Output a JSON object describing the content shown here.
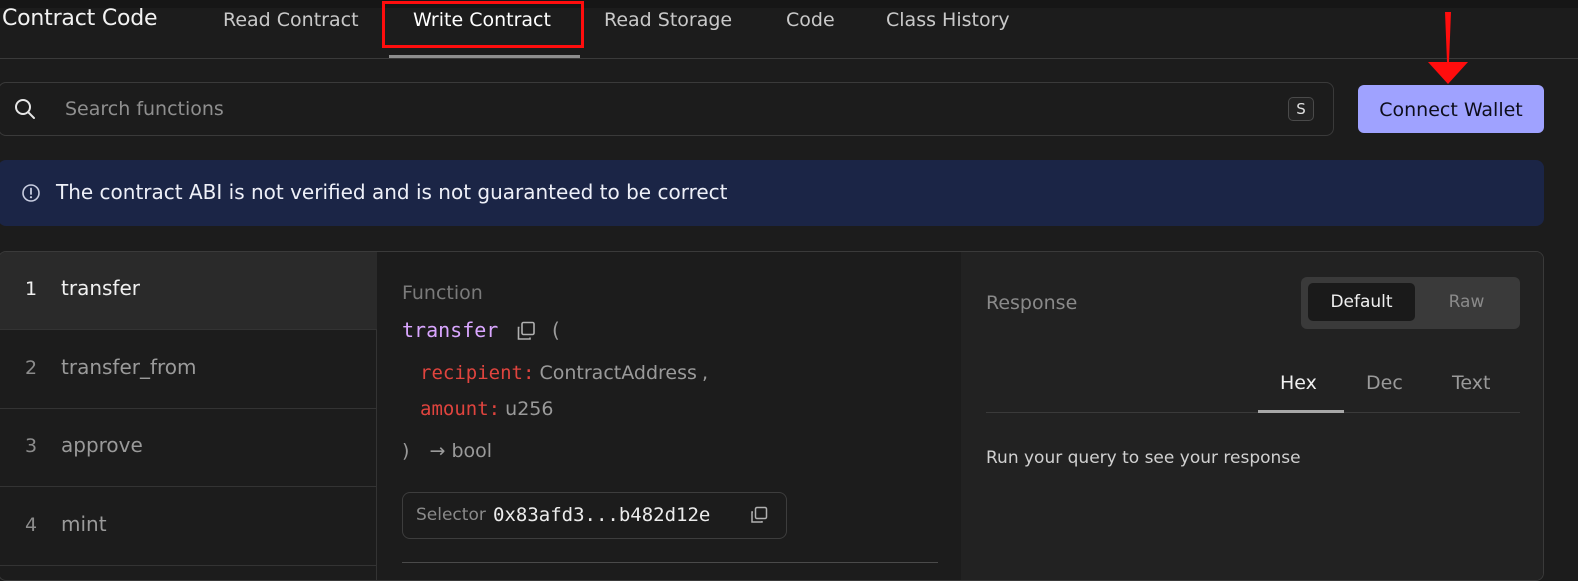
{
  "header": {
    "title": "Contract Code",
    "tabs": [
      {
        "label": "Read Contract"
      },
      {
        "label": "Write Contract"
      },
      {
        "label": "Read Storage"
      },
      {
        "label": "Code"
      },
      {
        "label": "Class History"
      }
    ],
    "active_tab": "Write Contract"
  },
  "search": {
    "placeholder": "Search functions",
    "value": "",
    "shortcut": "S"
  },
  "connect_wallet": {
    "label": "Connect Wallet"
  },
  "banner": {
    "text": "The contract ABI is not verified and is not guaranteed to be correct"
  },
  "functions": [
    {
      "num": "1",
      "name": "transfer"
    },
    {
      "num": "2",
      "name": "transfer_from"
    },
    {
      "num": "3",
      "name": "approve"
    },
    {
      "num": "4",
      "name": "mint"
    }
  ],
  "function_detail": {
    "label": "Function",
    "name": "transfer",
    "open_paren": "(",
    "close_paren": ")",
    "params": [
      {
        "name": "recipient:",
        "type": "ContractAddress",
        "sep": ","
      },
      {
        "name": "amount:",
        "type": "u256",
        "sep": ""
      }
    ],
    "return_arrow": "→",
    "return_type": "bool",
    "selector_label": "Selector",
    "selector_value": "0x83afd3...b482d12e"
  },
  "response": {
    "label": "Response",
    "toggle": [
      {
        "label": "Default"
      },
      {
        "label": "Raw"
      }
    ],
    "format_tabs": [
      {
        "label": "Hex"
      },
      {
        "label": "Dec"
      },
      {
        "label": "Text"
      }
    ],
    "empty_text": "Run your query to see your response"
  },
  "colors": {
    "accent_button": "#9fa2ff",
    "annotation_red": "#ff0d0d",
    "banner_bg": "#1b2546",
    "function_name": "#d9a6ff",
    "param_name": "#e0443e"
  }
}
